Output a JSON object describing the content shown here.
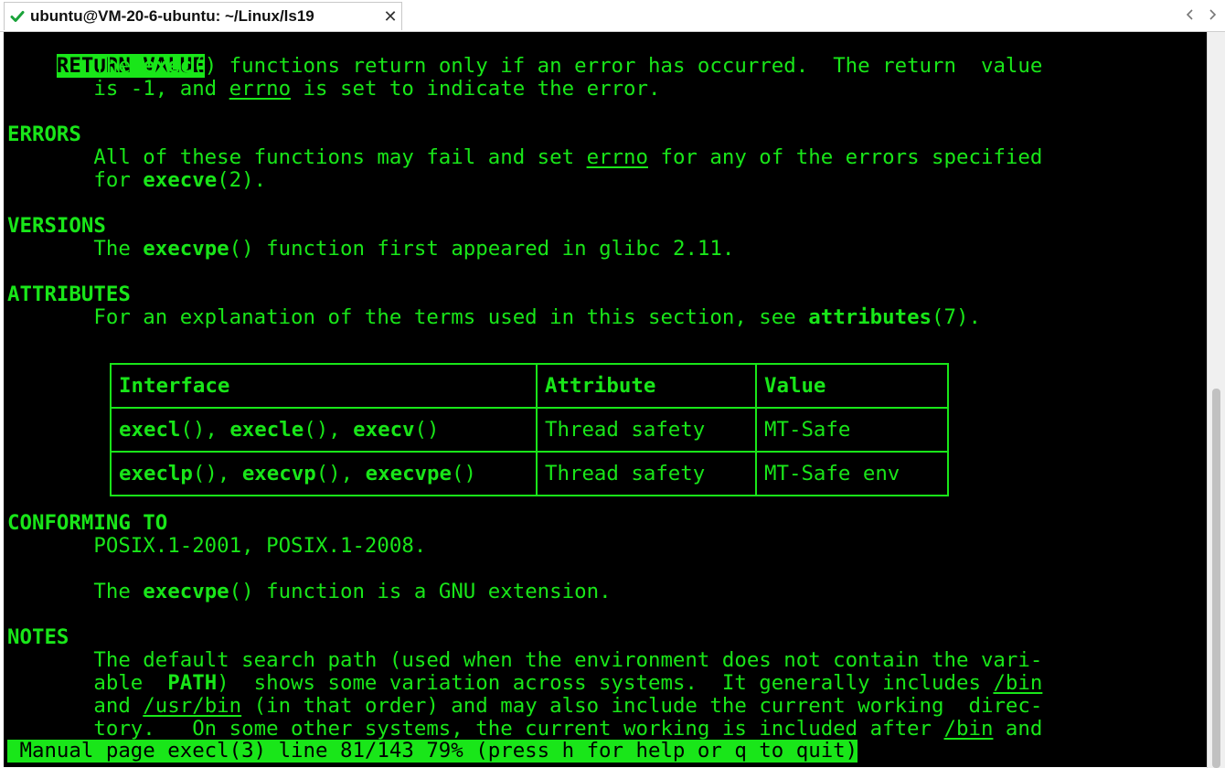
{
  "window": {
    "tab_title": "ubuntu@VM-20-6-ubuntu: ~/Linux/ls19",
    "close_glyph": "✕"
  },
  "terminal": {
    "return_value": {
      "heading": "RETURN VALUE",
      "l1_a": "       The ",
      "l1_b": "exec",
      "l1_c": "() functions return only if an error has occurred.  The return  value",
      "l2_a": "       is -1, and ",
      "l2_b": "errno",
      "l2_c": " is set to indicate the error."
    },
    "errors": {
      "heading": "ERRORS",
      "l1_a": "       All of these functions may fail and set ",
      "l1_b": "errno",
      "l1_c": " for any of the errors specified",
      "l2_a": "       for ",
      "l2_b": "execve",
      "l2_c": "(2)."
    },
    "versions": {
      "heading": "VERSIONS",
      "l1_a": "       The ",
      "l1_b": "execvpe",
      "l1_c": "() function first appeared in glibc 2.11."
    },
    "attributes": {
      "heading": "ATTRIBUTES",
      "l1_a": "       For an explanation of the terms used in this section, see ",
      "l1_b": "attributes",
      "l1_c": "(7)."
    },
    "table": {
      "headers": [
        "Interface",
        "Attribute",
        "Value"
      ],
      "rows": [
        {
          "f1": "execl",
          "s1": "(), ",
          "f2": "execle",
          "s2": "(), ",
          "f3": "execv",
          "s3": "()",
          "attribute": "Thread safety",
          "value": "MT-Safe"
        },
        {
          "f1": "execlp",
          "s1": "(), ",
          "f2": "execvp",
          "s2": "(), ",
          "f3": "execvpe",
          "s3": "()",
          "attribute": "Thread safety",
          "value": "MT-Safe env"
        }
      ]
    },
    "conforming": {
      "heading": "CONFORMING TO",
      "l1": "       POSIX.1-2001, POSIX.1-2008.",
      "l2_a": "       The ",
      "l2_b": "execvpe",
      "l2_c": "() function is a GNU extension."
    },
    "notes": {
      "heading": "NOTES",
      "l1": "       The default search path (used when the environment does not contain the vari‐",
      "l2_a": "       able  ",
      "l2_b": "PATH",
      "l2_c": ")  shows some variation across systems.  It generally includes ",
      "l2_d": "/bin",
      "l3_a": "       and ",
      "l3_b": "/usr/bin",
      "l3_c": " (in that order) and may also include the current working  direc‐",
      "l4_a": "       tory.   On some other systems, the current working is included after ",
      "l4_b": "/bin",
      "l4_c": " and"
    },
    "status_line": " Manual page execl(3) line 81/143 79% (press h for help or q to quit)"
  },
  "colors": {
    "terminal_bg": "#000000",
    "terminal_fg": "#19e619"
  },
  "icons": {
    "tab_status": "check-icon",
    "tab_close": "close-icon",
    "nav_left": "chevron-left-icon",
    "nav_right": "chevron-right-icon"
  }
}
